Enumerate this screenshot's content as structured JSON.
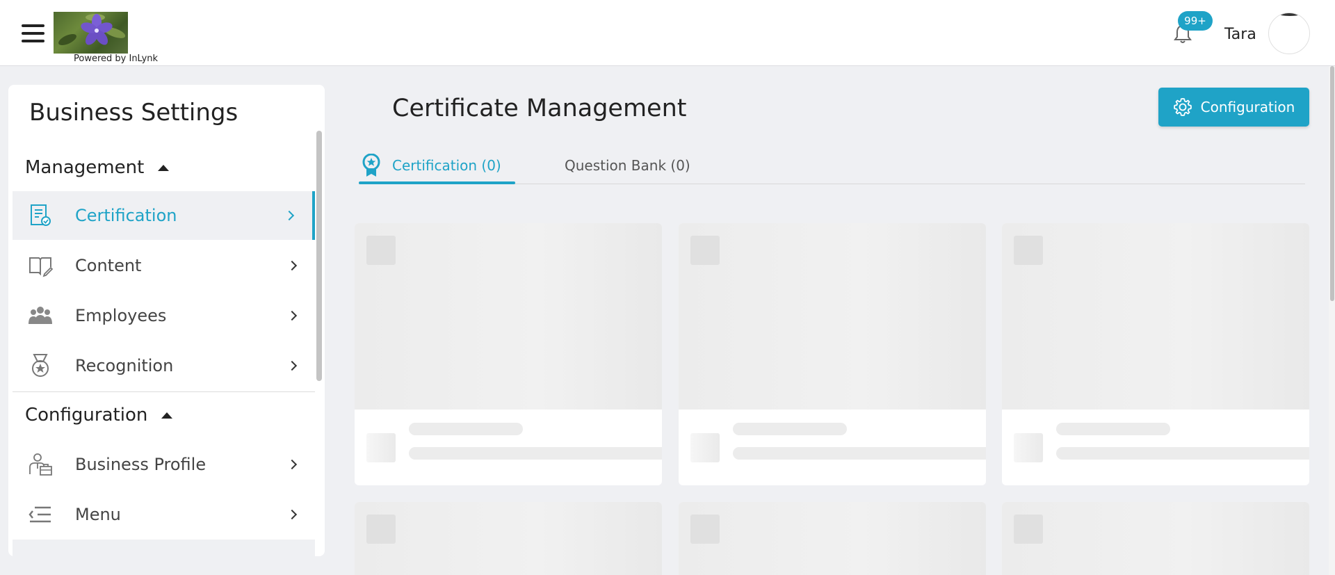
{
  "header": {
    "logo_caption": "Powered by InLynk",
    "notifications_badge": "99+",
    "user_name": "Tara"
  },
  "sidebar": {
    "title": "Business Settings",
    "sections": [
      {
        "label": "Management",
        "items": [
          {
            "label": "Certification",
            "icon": "certificate-icon",
            "active": true
          },
          {
            "label": "Content",
            "icon": "book-edit-icon"
          },
          {
            "label": "Employees",
            "icon": "people-group-icon"
          },
          {
            "label": "Recognition",
            "icon": "medal-icon"
          }
        ]
      },
      {
        "label": "Configuration",
        "items": [
          {
            "label": "Business Profile",
            "icon": "business-person-icon"
          },
          {
            "label": "Menu",
            "icon": "menu-lines-icon"
          }
        ]
      }
    ]
  },
  "main": {
    "title": "Certificate Management",
    "config_button_label": "Configuration",
    "tabs": [
      {
        "label": "Certification (0)",
        "icon": "ribbon-badge-icon",
        "active": true
      },
      {
        "label": "Question Bank (0)",
        "active": false
      }
    ]
  },
  "colors": {
    "accent": "#1fa3c7",
    "background": "#eff0f3",
    "card": "#ffffff"
  }
}
